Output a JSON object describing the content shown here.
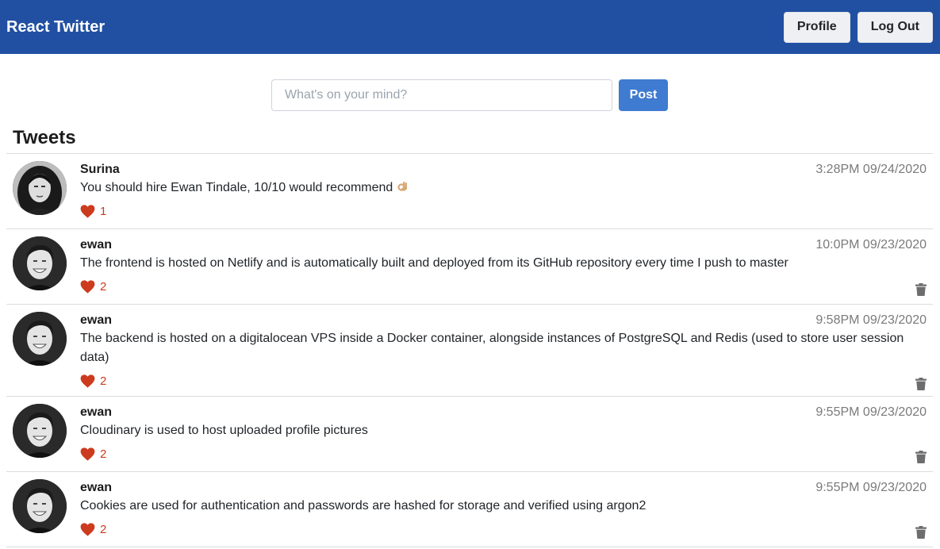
{
  "navbar": {
    "brand": "React Twitter",
    "profile_label": "Profile",
    "logout_label": "Log Out"
  },
  "composer": {
    "placeholder": "What's on your mind?",
    "value": "",
    "post_label": "Post"
  },
  "tweets_heading": "Tweets",
  "colors": {
    "navbar": "#2150a3",
    "post_button": "#3f7bd0",
    "like": "#cc3b1e"
  },
  "tweets": [
    {
      "username": "Surina",
      "time": "3:28PM 09/24/2020",
      "text": "You should hire Ewan Tindale, 10/10 would recommend",
      "emoji": "ok-hand",
      "likes": "1",
      "deletable": false,
      "avatar": "surina"
    },
    {
      "username": "ewan",
      "time": "10:0PM 09/23/2020",
      "text": "The frontend is hosted on Netlify and is automatically built and deployed from its GitHub repository every time I push to master",
      "likes": "2",
      "deletable": true,
      "avatar": "ewan"
    },
    {
      "username": "ewan",
      "time": "9:58PM 09/23/2020",
      "text": "The backend is hosted on a digitalocean VPS inside a Docker container, alongside instances of PostgreSQL and Redis (used to store user session data)",
      "likes": "2",
      "deletable": true,
      "avatar": "ewan"
    },
    {
      "username": "ewan",
      "time": "9:55PM 09/23/2020",
      "text": "Cloudinary is used to host uploaded profile pictures",
      "likes": "2",
      "deletable": true,
      "avatar": "ewan"
    },
    {
      "username": "ewan",
      "time": "9:55PM 09/23/2020",
      "text": "Cookies are used for authentication and passwords are hashed for storage and verified using argon2",
      "likes": "2",
      "deletable": true,
      "avatar": "ewan"
    }
  ]
}
